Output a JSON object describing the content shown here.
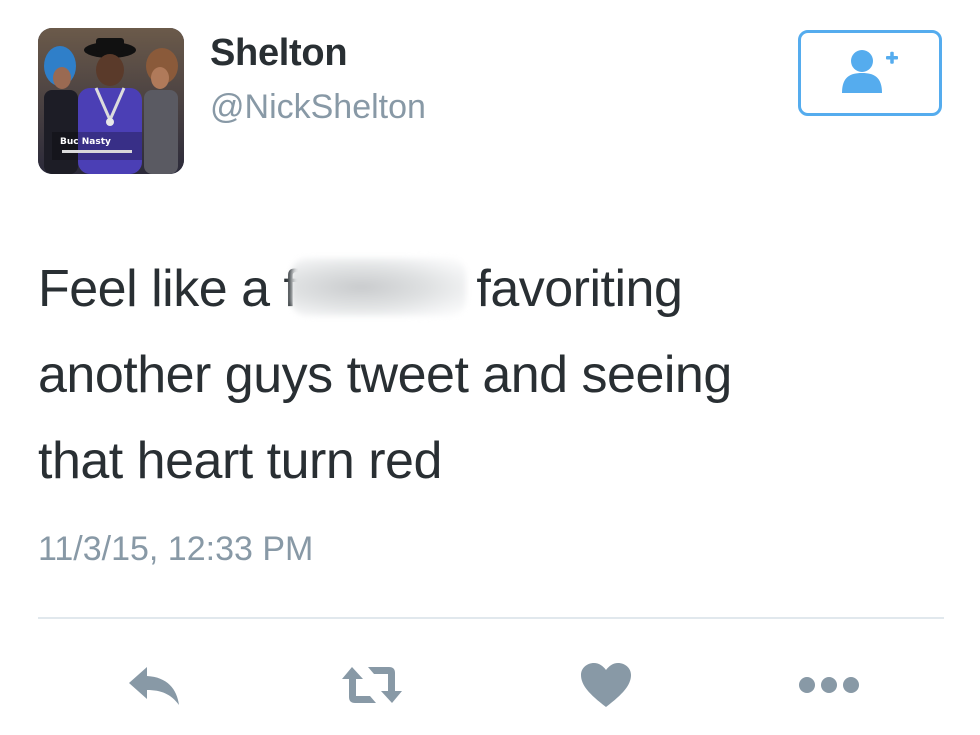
{
  "user": {
    "display_name": "Shelton",
    "handle": "@NickShelton",
    "avatar_caption": "Buc Nasty"
  },
  "follow_button": {
    "icon": "add-user-icon"
  },
  "tweet": {
    "line1_prefix": "Feel like a f",
    "line1_suffix": "favoriting",
    "line2": "another guys tweet and seeing",
    "line3": "that heart turn red",
    "timestamp": "11/3/15, 12:33 PM"
  },
  "actions": [
    {
      "name": "reply",
      "icon": "reply-icon"
    },
    {
      "name": "retweet",
      "icon": "retweet-icon"
    },
    {
      "name": "like",
      "icon": "heart-icon"
    },
    {
      "name": "more",
      "icon": "more-icon"
    }
  ],
  "colors": {
    "text_primary": "#292f33",
    "text_secondary": "#8899a6",
    "accent": "#55acee",
    "icon_gray": "#8899a6",
    "divider": "#e1e8ed"
  }
}
